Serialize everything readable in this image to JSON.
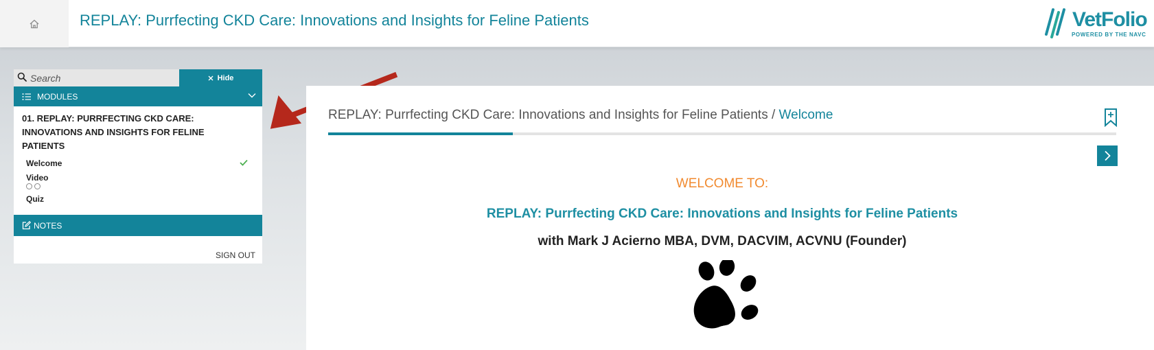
{
  "header": {
    "title": "REPLAY: Purrfecting CKD Care: Innovations and Insights for Feline Patients",
    "home_icon": "home-icon",
    "logo": {
      "name": "VetFolio",
      "tagline": "POWERED BY THE NAVC"
    }
  },
  "sidebar": {
    "search": {
      "placeholder": "Search",
      "value": ""
    },
    "hide_label": "Hide",
    "modules_label": "MODULES",
    "module_title": "01. REPLAY: PURRFECTING CKD CARE: INNOVATIONS AND INSIGHTS FOR FELINE PATIENTS",
    "lessons": [
      {
        "label": "Welcome",
        "status": "complete"
      },
      {
        "label": "Video",
        "status": "not-started"
      },
      {
        "label": "Quiz",
        "status": "not-started"
      }
    ],
    "notes_label": "NOTES",
    "sign_out_label": "SIGN OUT"
  },
  "main": {
    "breadcrumb": {
      "course": "REPLAY: Purrfecting CKD Care: Innovations and Insights for Feline Patients",
      "separator": " / ",
      "current": "Welcome"
    },
    "progress": 0.234,
    "welcome_to": "WELCOME TO:",
    "course_title": "REPLAY: Purrfecting CKD Care: Innovations and Insights for Feline Patients",
    "presenter": "with Mark J Acierno MBA, DVM, DACVIM, ACVNU (Founder)",
    "image_icon": "paw-print-icon"
  },
  "colors": {
    "accent": "#13849a",
    "orange": "#f18a2f",
    "arrow": "#b5281c",
    "check": "#4caf50"
  }
}
